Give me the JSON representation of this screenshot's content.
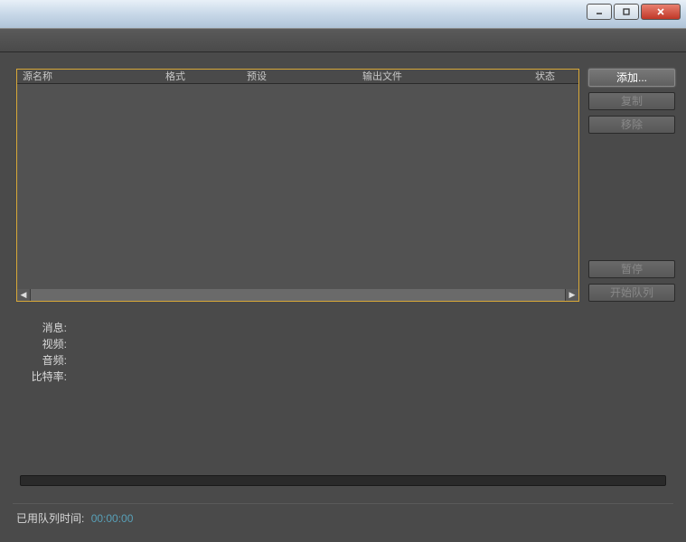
{
  "window": {
    "minimize_icon": "minimize-icon",
    "maximize_icon": "maximize-icon",
    "close_icon": "close-icon"
  },
  "queue": {
    "columns": {
      "source": "源名称",
      "format": "格式",
      "preset": "预设",
      "output": "输出文件",
      "status": "状态"
    }
  },
  "buttons": {
    "add": "添加...",
    "duplicate": "复制",
    "remove": "移除",
    "pause": "暂停",
    "start_queue": "开始队列"
  },
  "info": {
    "message_label": "消息:",
    "video_label": "视频:",
    "audio_label": "音频:",
    "bitrate_label": "比特率:"
  },
  "status": {
    "elapsed_label": "已用队列时间:",
    "elapsed_value": "00:00:00"
  }
}
